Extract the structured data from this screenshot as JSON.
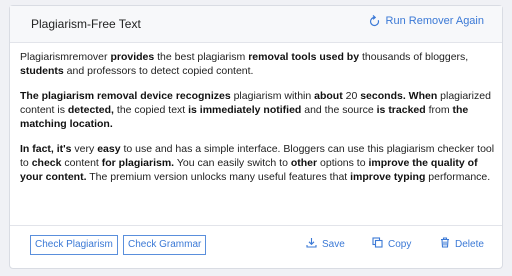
{
  "header": {
    "title": "Plagiarism-Free Text",
    "run_label": "Run Remover Again",
    "run_icon": "refresh-icon"
  },
  "content": {
    "paragraphs": [
      [
        {
          "t": "Plagiarismremover ",
          "b": false
        },
        {
          "t": "provides",
          "b": true
        },
        {
          "t": " the best plagiarism ",
          "b": false
        },
        {
          "t": "removal tools used by",
          "b": true
        },
        {
          "t": " thousands of bloggers, ",
          "b": false
        },
        {
          "t": "students",
          "b": true
        },
        {
          "t": " and professors to detect copied content.",
          "b": false
        }
      ],
      [
        {
          "t": "The plagiarism removal device recognizes",
          "b": true
        },
        {
          "t": " plagiarism within ",
          "b": false
        },
        {
          "t": "about",
          "b": true
        },
        {
          "t": " 20 ",
          "b": false
        },
        {
          "t": "seconds. When",
          "b": true
        },
        {
          "t": " plagiarized content is ",
          "b": false
        },
        {
          "t": "detected,",
          "b": true
        },
        {
          "t": " the copied text ",
          "b": false
        },
        {
          "t": "is immediately notified",
          "b": true
        },
        {
          "t": " and the source ",
          "b": false
        },
        {
          "t": "is tracked",
          "b": true
        },
        {
          "t": " from ",
          "b": false
        },
        {
          "t": "the matching location.",
          "b": true
        }
      ],
      [
        {
          "t": "In fact, it's",
          "b": true
        },
        {
          "t": " very ",
          "b": false
        },
        {
          "t": "easy",
          "b": true
        },
        {
          "t": " to use and has a simple interface. Bloggers can use this plagiarism checker tool to ",
          "b": false
        },
        {
          "t": "check",
          "b": true
        },
        {
          "t": " content ",
          "b": false
        },
        {
          "t": "for plagiarism.",
          "b": true
        },
        {
          "t": " You can easily switch to ",
          "b": false
        },
        {
          "t": "other",
          "b": true
        },
        {
          "t": " options to ",
          "b": false
        },
        {
          "t": "improve the quality of your content.",
          "b": true
        },
        {
          "t": " The premium version unlocks many useful features that ",
          "b": false
        },
        {
          "t": "improve typing",
          "b": true
        },
        {
          "t": " performance.",
          "b": false
        }
      ]
    ]
  },
  "footer": {
    "check_plagiarism": "Check Plagiarism",
    "check_grammar": "Check Grammar",
    "save": "Save",
    "copy": "Copy",
    "delete": "Delete"
  },
  "colors": {
    "accent": "#3b79d6",
    "border": "#d9dce3",
    "background": "#f0f1f5"
  }
}
